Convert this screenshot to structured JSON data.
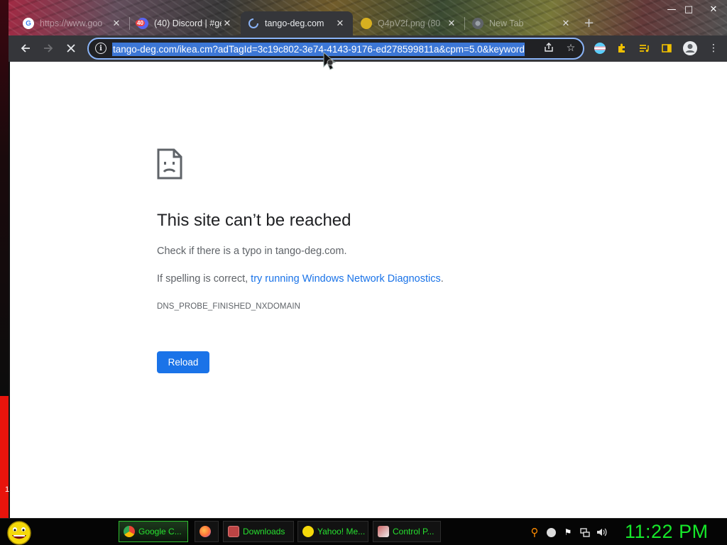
{
  "browser": {
    "tabs": [
      {
        "label": "https://www.goo",
        "favicon": "google-icon",
        "faded": true,
        "active": false
      },
      {
        "label": "(40) Discord | #ge",
        "favicon": "discord-icon",
        "badge": "40",
        "faded": false,
        "active": false
      },
      {
        "label": "tango-deg.com",
        "favicon": "loading-spinner-icon",
        "faded": false,
        "active": true
      },
      {
        "label": "Q4pV2f.png (80",
        "favicon": "image-icon",
        "faded": true,
        "active": false
      },
      {
        "label": "New Tab",
        "favicon": "chrome-icon",
        "faded": true,
        "active": false
      }
    ],
    "new_tab_symbol": "+",
    "window_controls": {
      "minimize": "—",
      "maximize": "□",
      "close": "✕"
    },
    "address_bar": {
      "url": "tango-deg.com/ikea.cm?adTagId=3c19c802-3e74-4143-9176-ed278599811a&cpm=5.0&keyword",
      "selected": true
    }
  },
  "error_page": {
    "title": "This site can’t be reached",
    "typo_hint": "Check if there is a typo in tango-deg.com.",
    "spelling_prefix": "If spelling is correct, ",
    "diagnostics_link": "try running Windows Network Diagnostics",
    "spelling_suffix": ".",
    "error_code": "DNS_PROBE_FINISHED_NXDOMAIN",
    "reload_label": "Reload"
  },
  "taskbar": {
    "buttons": [
      {
        "label": "Google C...",
        "icon": "chrome-icon",
        "active": true
      },
      {
        "label": "",
        "icon": "firefox-icon",
        "active": false
      },
      {
        "label": "Downloads",
        "icon": "folder-icon",
        "active": false
      },
      {
        "label": "Yahoo! Me...",
        "icon": "yahoo-messenger-icon",
        "active": false
      },
      {
        "label": "Control P...",
        "icon": "control-panel-icon",
        "active": false
      }
    ],
    "clock": "11:22 PM"
  },
  "colors": {
    "accent_blue": "#1a73e8",
    "toolbar": "#35363a",
    "clock_green": "#16e82a",
    "taskbar_text": "#27e02f"
  }
}
